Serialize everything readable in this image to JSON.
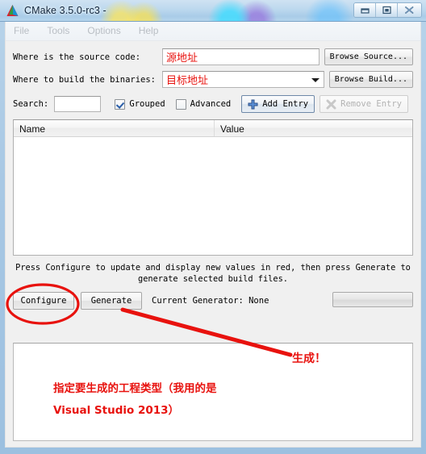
{
  "window": {
    "title": "CMake 3.5.0-rc3 -",
    "logo_icon": "cmake-triangle-logo",
    "caption_buttons": [
      {
        "name": "minimize",
        "icon": "minimize-icon"
      },
      {
        "name": "maximize",
        "icon": "maximize-icon"
      },
      {
        "name": "close",
        "icon": "close-icon"
      }
    ]
  },
  "menubar": {
    "items": [
      {
        "label": "File"
      },
      {
        "label": "Tools"
      },
      {
        "label": "Options"
      },
      {
        "label": "Help"
      }
    ]
  },
  "form": {
    "source_row": {
      "label": "Where is the source code:",
      "value": "源地址",
      "placeholder": "",
      "button_label": "Browse Source..."
    },
    "build_row": {
      "label": "Where to build the binaries:",
      "value": "目标地址",
      "placeholder": "",
      "button_label": "Browse Build...",
      "dropdown_icon": "chevron-down-icon"
    }
  },
  "search": {
    "label": "Search:",
    "value": "",
    "placeholder": "",
    "grouped": {
      "label": "Grouped",
      "checked": true
    },
    "advanced": {
      "label": "Advanced",
      "checked": false
    },
    "add_entry": {
      "label": "Add Entry",
      "icon": "plus-icon",
      "enabled": true
    },
    "remove_entry": {
      "label": "Remove Entry",
      "icon": "remove-x-icon",
      "enabled": false
    }
  },
  "cache_table": {
    "columns": [
      "Name",
      "Value"
    ],
    "rows": []
  },
  "hint": {
    "line1": "Press Configure to update and display new values in red, then press Generate to",
    "line2": "generate selected build files."
  },
  "actions": {
    "configure_label": "Configure",
    "generate_label": "Generate",
    "generator_status": "Current Generator: None",
    "progress_value": 0
  },
  "output": {
    "text": ""
  },
  "annotations": {
    "accent_color": "#e8120e",
    "generate_callout": "生成！",
    "note_line1": "指定要生成的工程类型（我用的是",
    "note_line2": "Visual Studio 2013）",
    "ellipse_target": "configure-button",
    "arrow_from": "generate-button",
    "arrow_to": "generate-callout"
  }
}
